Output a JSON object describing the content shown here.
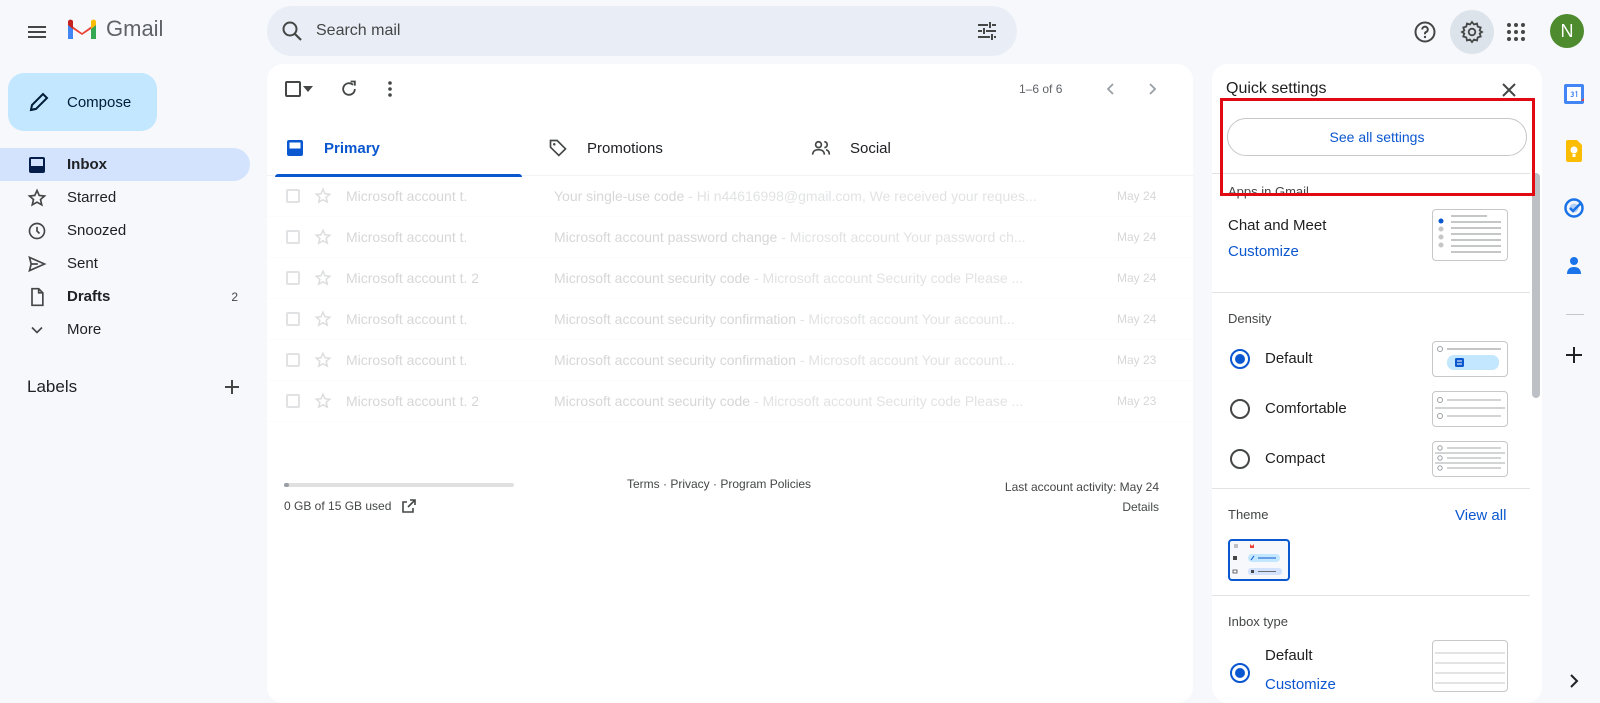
{
  "header": {
    "app_name": "Gmail",
    "search_placeholder": "Search mail",
    "avatar_letter": "N"
  },
  "sidebar": {
    "compose_label": "Compose",
    "items": [
      {
        "label": "Inbox",
        "count": "",
        "icon": "inbox-icon",
        "active": true
      },
      {
        "label": "Starred",
        "count": "",
        "icon": "star-icon"
      },
      {
        "label": "Snoozed",
        "count": "",
        "icon": "clock-icon"
      },
      {
        "label": "Sent",
        "count": "",
        "icon": "send-icon"
      },
      {
        "label": "Drafts",
        "count": "2",
        "icon": "draft-icon"
      },
      {
        "label": "More",
        "count": "",
        "icon": "chevron-down-icon"
      }
    ],
    "labels_title": "Labels"
  },
  "toolbar": {
    "pager": "1–6 of 6"
  },
  "tabs": [
    {
      "label": "Primary",
      "active": true
    },
    {
      "label": "Promotions"
    },
    {
      "label": "Social"
    }
  ],
  "emails": [
    {
      "sender": "Microsoft account t.",
      "count": "",
      "subject": "Your single-use code",
      "snippet": " - Hi n44616998@gmail.com, We received your reques...",
      "date": "May 24"
    },
    {
      "sender": "Microsoft account t.",
      "count": "",
      "subject": "Microsoft account password change",
      "snippet": " - Microsoft account Your password ch...",
      "date": "May 24"
    },
    {
      "sender": "Microsoft account t.",
      "count": "2",
      "subject": "Microsoft account security code",
      "snippet": " - Microsoft account Security code Please ...",
      "date": "May 24"
    },
    {
      "sender": "Microsoft account t.",
      "count": "",
      "subject": "Microsoft account security confirmation",
      "snippet": " - Microsoft account Your account...",
      "date": "May 24"
    },
    {
      "sender": "Microsoft account t.",
      "count": "",
      "subject": "Microsoft account security confirmation",
      "snippet": " - Microsoft account Your account...",
      "date": "May 23"
    },
    {
      "sender": "Microsoft account t.",
      "count": "2",
      "subject": "Microsoft account security code",
      "snippet": " - Microsoft account Security code Please ...",
      "date": "May 23"
    }
  ],
  "footer": {
    "storage": "0 GB of 15 GB used",
    "storage_fraction": 0.0,
    "terms": "Terms",
    "privacy": "Privacy",
    "policies": "Program Policies",
    "separator": " · ",
    "activity": "Last account activity: May 24",
    "details": "Details"
  },
  "quick_settings": {
    "title": "Quick settings",
    "see_all": "See all settings",
    "apps_title": "Apps in Gmail",
    "chat_meet": "Chat and Meet",
    "customize": "Customize",
    "density_title": "Density",
    "density_options": [
      {
        "label": "Default",
        "selected": true
      },
      {
        "label": "Comfortable",
        "selected": false
      },
      {
        "label": "Compact",
        "selected": false
      }
    ],
    "theme_title": "Theme",
    "view_all": "View all",
    "inbox_type_title": "Inbox type",
    "inbox_default": "Default",
    "inbox_customize": "Customize"
  },
  "colors": {
    "accent": "#0b57d0",
    "highlight": "#e00a12",
    "avatar": "#4e8b2e"
  }
}
